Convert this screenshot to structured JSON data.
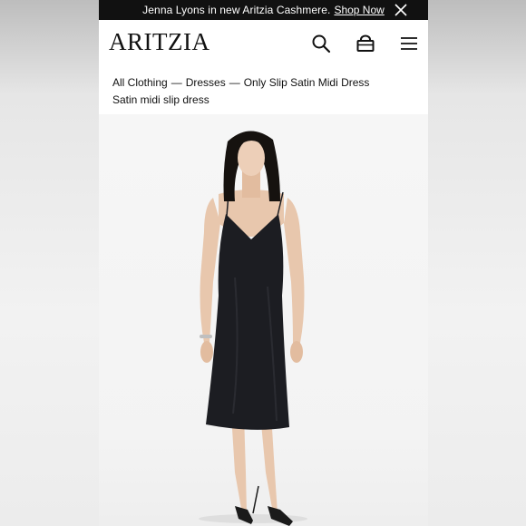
{
  "promo": {
    "text": "Jenna Lyons in new Aritzia Cashmere.",
    "link": "Shop Now"
  },
  "header": {
    "logo": "ARITZIA",
    "icons": [
      "search-icon",
      "bag-icon",
      "menu-icon"
    ]
  },
  "breadcrumb": {
    "items": [
      "All Clothing",
      "Dresses",
      "Only Slip Satin Midi Dress"
    ],
    "separator": "—"
  },
  "product": {
    "subtitle": "Satin midi slip dress"
  },
  "colors": {
    "promo_bg": "#111111",
    "dress": "#1c1d22"
  }
}
